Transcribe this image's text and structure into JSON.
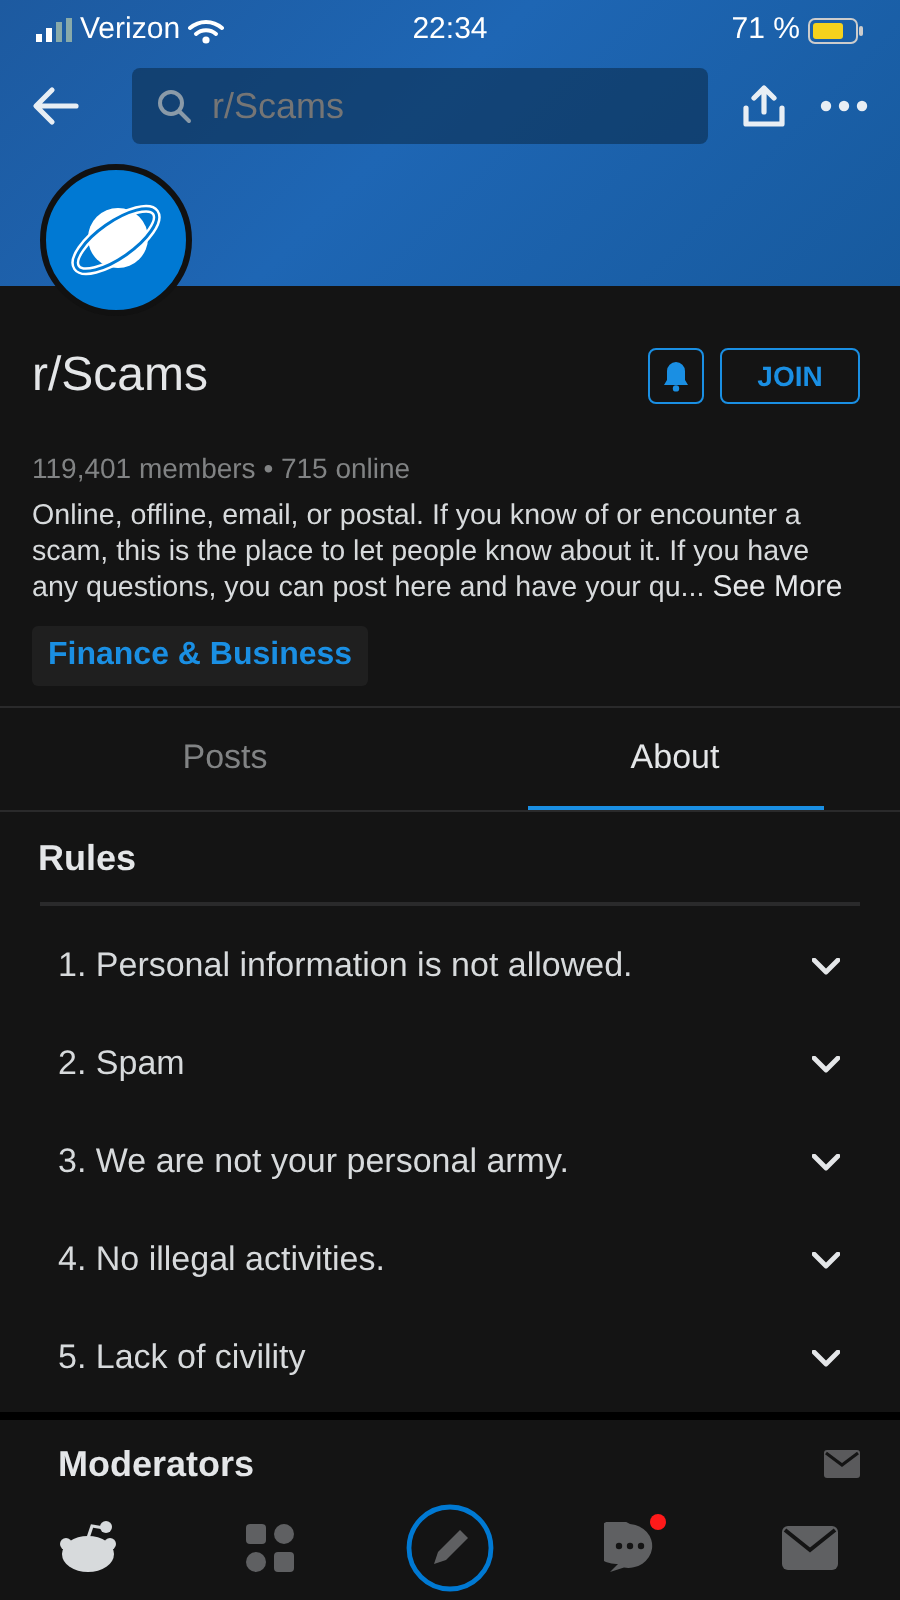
{
  "status_bar": {
    "carrier": "Verizon",
    "time": "22:34",
    "battery": "71 %"
  },
  "search": {
    "placeholder": "r/Scams"
  },
  "community": {
    "name": "r/Scams",
    "joined": false,
    "join_label": "JOIN",
    "stats": "119,401 members • 715 online",
    "description": "Online, offline, email, or postal. If you know of or encounter a scam, this is the place to let people know about it. If you have any questions, you can post here and have your qu...",
    "see_more": "See More",
    "topic": "Finance & Business"
  },
  "tabs": [
    {
      "label": "Posts",
      "selected": false
    },
    {
      "label": "About",
      "selected": true
    }
  ],
  "rules": {
    "title": "Rules",
    "items": [
      {
        "label": "1. Personal information is not allowed.",
        "expanded": false
      },
      {
        "label": "2. Spam",
        "expanded": false
      },
      {
        "label": "3. We are not your personal army.",
        "expanded": false
      },
      {
        "label": "4. No illegal activities.",
        "expanded": false
      },
      {
        "label": "5. Lack of civility",
        "expanded": false
      }
    ]
  },
  "moderators": {
    "title": "Moderators"
  },
  "bottom_nav": [
    {
      "kind": "home",
      "selected": true,
      "notification": false
    },
    {
      "kind": "communities",
      "selected": false,
      "notification": false
    },
    {
      "kind": "post",
      "selected": false,
      "notification": false
    },
    {
      "kind": "chat",
      "selected": false,
      "notification": true
    },
    {
      "kind": "inbox",
      "selected": false,
      "notification": false
    }
  ]
}
